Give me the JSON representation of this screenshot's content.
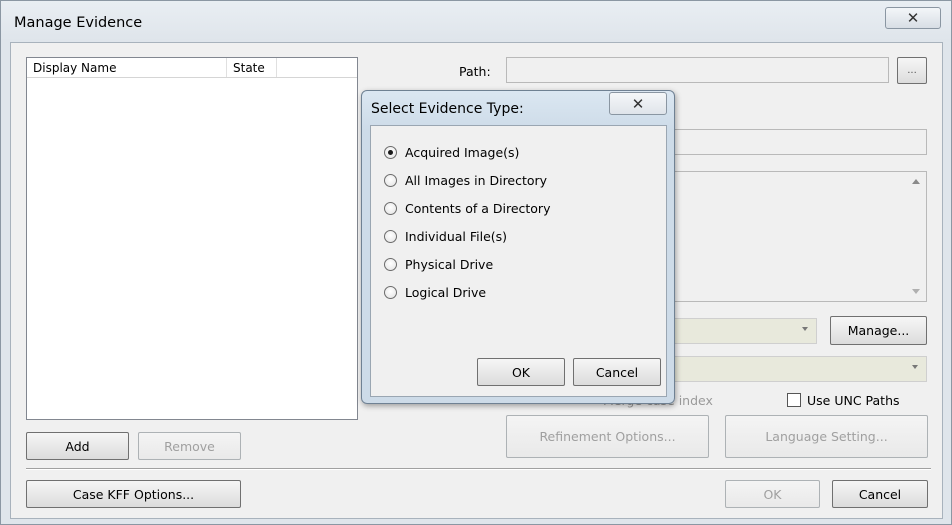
{
  "window": {
    "title": "Manage Evidence",
    "close_glyph": "✕"
  },
  "evidence_list": {
    "columns": [
      "Display Name",
      "State"
    ]
  },
  "left_buttons": {
    "add": "Add",
    "remove": "Remove",
    "case_kff": "Case KFF Options..."
  },
  "form": {
    "path_label": "Path:",
    "browse_label": "...",
    "manage_label": "Manage...",
    "merge_case_index_label": "Merge case index",
    "use_unc_paths_label": "Use UNC Paths",
    "refinement_label": "Refinement Options...",
    "language_label": "Language Setting..."
  },
  "bottom_buttons": {
    "ok": "OK",
    "cancel": "Cancel"
  },
  "dialog": {
    "title": "Select Evidence Type:",
    "close_glyph": "✕",
    "options": [
      {
        "label": "Acquired Image(s)",
        "selected": true
      },
      {
        "label": "All Images in Directory",
        "selected": false
      },
      {
        "label": "Contents of a Directory",
        "selected": false
      },
      {
        "label": "Individual File(s)",
        "selected": false
      },
      {
        "label": "Physical Drive",
        "selected": false
      },
      {
        "label": "Logical Drive",
        "selected": false
      }
    ],
    "ok": "OK",
    "cancel": "Cancel"
  },
  "icons": {
    "close": "close-icon",
    "dropdown": "chevron-down-icon",
    "scroll_up": "scroll-up-icon",
    "scroll_down": "scroll-down-icon"
  }
}
